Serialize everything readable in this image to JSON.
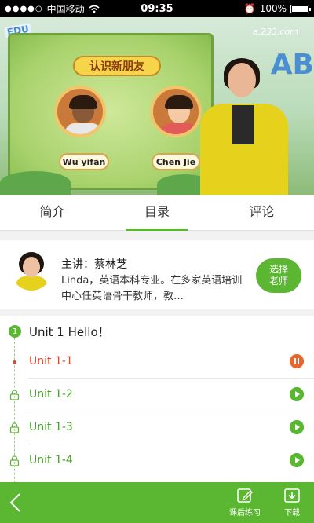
{
  "status_bar": {
    "carrier": "中国移动",
    "time": "09:35",
    "battery": "100%",
    "battery_level": 1.0
  },
  "video": {
    "watermark": "a.233.com",
    "edu_badge": "EDU",
    "board_title": "认识新朋友",
    "name_left": "Wu yifan",
    "name_right": "Chen  Jie",
    "deco_letters": "AB"
  },
  "tabs": [
    {
      "label": "简介",
      "active": false
    },
    {
      "label": "目录",
      "active": true
    },
    {
      "label": "评论",
      "active": false
    }
  ],
  "teacher": {
    "name": "主讲：蔡林芝",
    "description": "Linda，英语本科专业。在多家英语培训中心任英语骨干教师，教…",
    "choose_button": "选择\n老师"
  },
  "unit": {
    "number": "1",
    "title": "Unit 1 Hello！"
  },
  "lessons": [
    {
      "label": "Unit 1-1",
      "state": "playing"
    },
    {
      "label": "Unit 1-2",
      "state": "locked"
    },
    {
      "label": "Unit 1-3",
      "state": "locked"
    },
    {
      "label": "Unit 1-4",
      "state": "locked"
    }
  ],
  "bottom_bar": {
    "practice_label": "课后练习",
    "download_label": "下载"
  },
  "colors": {
    "accent_green": "#5bb632",
    "current_red": "#e0472c",
    "pause_orange": "#e9672e"
  }
}
